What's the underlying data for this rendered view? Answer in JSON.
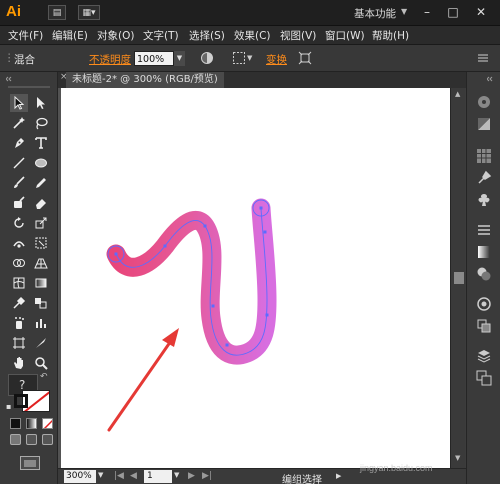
{
  "app": {
    "logo": "Ai"
  },
  "titlebar": {
    "workspace": "基本功能"
  },
  "menu": [
    "文件(F)",
    "编辑(E)",
    "对象(O)",
    "文字(T)",
    "选择(S)",
    "效果(C)",
    "视图(V)",
    "窗口(W)",
    "帮助(H)"
  ],
  "control": {
    "mode": "混合",
    "opacity_label": "不透明度",
    "opacity_value": "100%",
    "transform": "变换"
  },
  "document": {
    "tab_title": "未标题-2* @ 300% (RGB/预览)"
  },
  "statusbar": {
    "zoom": "300%",
    "page": "1",
    "status": "编组选择"
  },
  "watermark": "jingyan.baidu.com",
  "colors": {
    "accent": "#ff9a00",
    "stroke_pink": "#e8457a",
    "stroke_magenta": "#d86ee0",
    "arrow_red": "#e53935",
    "anchor_blue": "#5b6cff"
  }
}
